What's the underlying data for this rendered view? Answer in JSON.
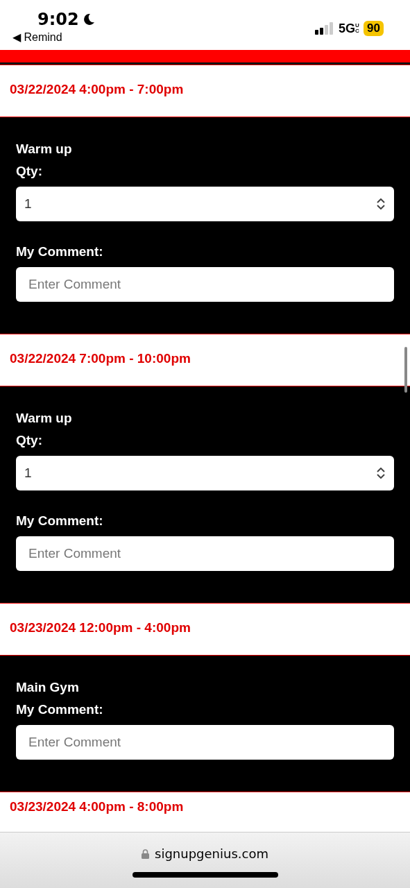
{
  "status_bar": {
    "time": "9:02",
    "back_label": "◀ Remind",
    "network": "5G",
    "network_suffix": "UC",
    "battery": "90"
  },
  "slots": [
    {
      "date": "03/22/2024 4:00pm - 7:00pm",
      "item": "Warm up",
      "fields": [
        {
          "kind": "select",
          "label": "Qty:",
          "value": "1"
        },
        {
          "kind": "text",
          "label": "My Comment:",
          "placeholder": "Enter Comment"
        }
      ]
    },
    {
      "date": "03/22/2024 7:00pm - 10:00pm",
      "item": "Warm up",
      "fields": [
        {
          "kind": "select",
          "label": "Qty:",
          "value": "1"
        },
        {
          "kind": "text",
          "label": "My Comment:",
          "placeholder": "Enter Comment"
        }
      ]
    },
    {
      "date": "03/23/2024 12:00pm - 4:00pm",
      "item": "Main Gym",
      "fields": [
        {
          "kind": "text",
          "label": "My Comment:",
          "placeholder": "Enter Comment"
        }
      ]
    },
    {
      "date": "03/23/2024 4:00pm - 8:00pm"
    }
  ],
  "browser_bar": {
    "url": "signupgenius.com"
  }
}
